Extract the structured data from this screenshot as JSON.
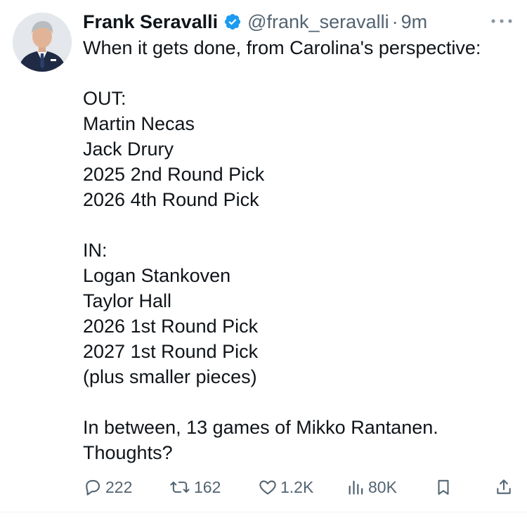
{
  "author": {
    "name": "Frank Seravalli",
    "handle": "@frank_seravalli",
    "separator": "·",
    "time": "9m"
  },
  "tweet": {
    "lines": [
      "When it gets done, from Carolina's perspective:",
      "",
      "OUT:",
      "Martin Necas",
      "Jack Drury",
      "2025 2nd Round Pick",
      "2026 4th Round Pick",
      "",
      "IN:",
      "Logan Stankoven",
      "Taylor Hall",
      "2026 1st Round Pick",
      "2027 1st Round Pick",
      "(plus smaller pieces)",
      "",
      "In between, 13 games of Mikko Rantanen.",
      "Thoughts?"
    ]
  },
  "actions": {
    "replies": "222",
    "reposts": "162",
    "likes": "1.2K",
    "views": "80K"
  },
  "colors": {
    "text": "#0f1419",
    "muted": "#536471",
    "verified": "#1d9bf0"
  },
  "icons": {
    "verified": "verified-badge-icon",
    "more": "more-dots-icon",
    "reply": "reply-icon",
    "repost": "repost-icon",
    "like": "heart-icon",
    "views": "views-bar-chart-icon",
    "bookmark": "bookmark-icon",
    "share": "share-icon"
  }
}
